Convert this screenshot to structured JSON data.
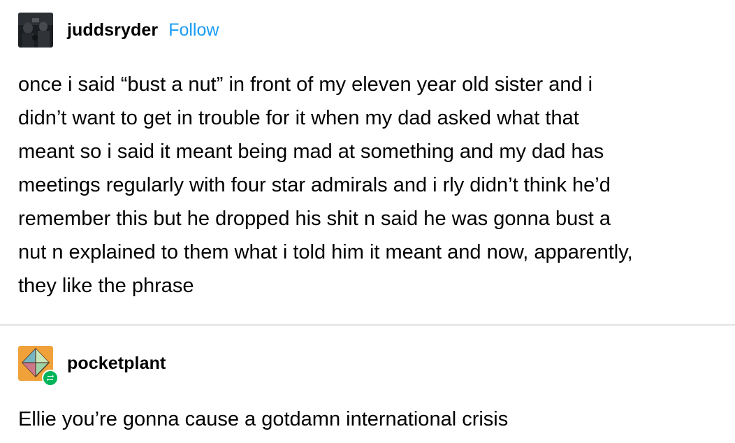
{
  "posts": [
    {
      "username": "juddsryder",
      "follow_label": "Follow",
      "avatar_icon": "dark-photo-avatar",
      "lines": [
        "once i said “bust a nut” in front of my eleven year old sister and i",
        "didn’t want to get in trouble for it when my dad asked what that",
        "meant so i said it meant being mad at something and my dad has",
        "meetings regularly with four star admirals and i rly didn’t think he’d",
        "remember this but he dropped his shit n said he was gonna bust a",
        "nut n explained to them what i told him it meant and now, apparently,",
        "they like the phrase"
      ]
    },
    {
      "username": "pocketplant",
      "avatar_icon": "diamond-plant-avatar",
      "badge_icon": "reblog-icon",
      "lines": [
        "Ellie you’re gonna cause a gotdamn international crisis"
      ]
    }
  ],
  "colors": {
    "follow": "#1a9cf5",
    "divider": "#e2e2e2",
    "reblog_badge": "#00b45a",
    "avatar2_bg": "#f0a13a"
  }
}
